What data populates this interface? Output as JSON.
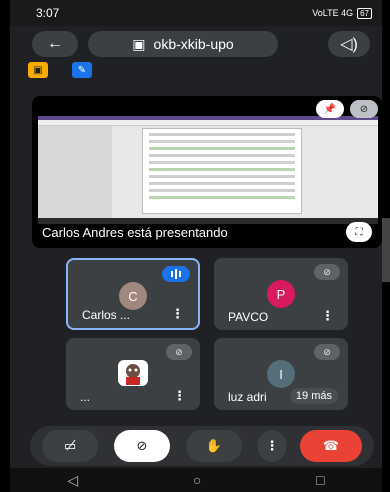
{
  "status_bar": {
    "time": "3:07",
    "signal": "VoLTE 4G",
    "battery": "67"
  },
  "header": {
    "meeting_code": "okb-xkib-upo",
    "back_icon": "arrow-left-icon",
    "speaker_icon": "speaker-icon"
  },
  "presentation": {
    "label": "Carlos Andres está presentando"
  },
  "participants": [
    {
      "initial": "C",
      "name": "Carlos ...",
      "color": "#a1887f"
    },
    {
      "initial": "P",
      "name": "PAVCO",
      "color": "#d81b60"
    },
    {
      "initial": "",
      "name": "..."
    },
    {
      "initial": "I",
      "name": "luz adri",
      "color": "#546e7a"
    }
  ],
  "others_count": "19 más",
  "controls": {
    "camera": "camera-off",
    "mic": "mic-off",
    "hand": "raise-hand",
    "more": "⋮",
    "hangup": "hang-up"
  },
  "colors": {
    "accent": "#8ab4f8",
    "hangup": "#ea4335"
  }
}
